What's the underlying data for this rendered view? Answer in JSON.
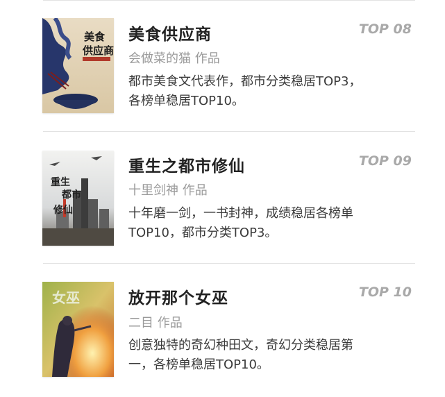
{
  "books": [
    {
      "title": "美食供应商",
      "rank": "TOP 08",
      "author": "会做菜的猫 作品",
      "desc_lines": [
        "都市美食文代表作，都市分类稳居TOP3，",
        "各榜单稳居TOP10。"
      ]
    },
    {
      "title": "重生之都市修仙",
      "rank": "TOP 09",
      "author": "十里剑神 作品",
      "desc_lines": [
        "十年磨一剑，一书封神，成绩稳居各榜单",
        "TOP10，都市分类TOP3。"
      ]
    },
    {
      "title": "放开那个女巫",
      "rank": "TOP 10",
      "author": "二目 作品",
      "desc_lines": [
        "创意独特的奇幻种田文，奇幻分类稳居第",
        "一，各榜单稳居TOP10。"
      ]
    }
  ],
  "colors": {
    "title": "#222222",
    "rank": "#a9a9a9",
    "author": "#9a9a9a",
    "desc": "#3a3a3a",
    "divider": "#e2e2e2"
  }
}
